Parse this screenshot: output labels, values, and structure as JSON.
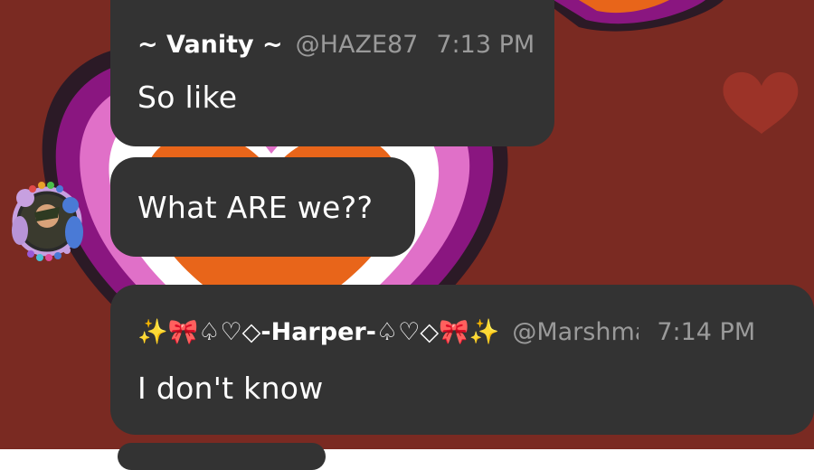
{
  "messages": [
    {
      "display_name": "~ Vanity ~",
      "handle": "@HAZE87",
      "time": "7:13 PM",
      "text": "So like"
    },
    {
      "text": "What ARE we??"
    },
    {
      "display_name": "✨🎀♤♡◇-Harper-♤♡◇🎀✨",
      "handle": "@Marshma",
      "time": "7:14 PM",
      "text": "I don't know"
    }
  ],
  "colors": {
    "bubble": "#333333",
    "meta_gray": "#9a9a9a",
    "background": "#7a2a22",
    "heart_purple": "#8a1680",
    "heart_pink": "#e070c8",
    "heart_orange": "#e8651a"
  },
  "icons": {
    "avatar": "sticker-avatar"
  }
}
